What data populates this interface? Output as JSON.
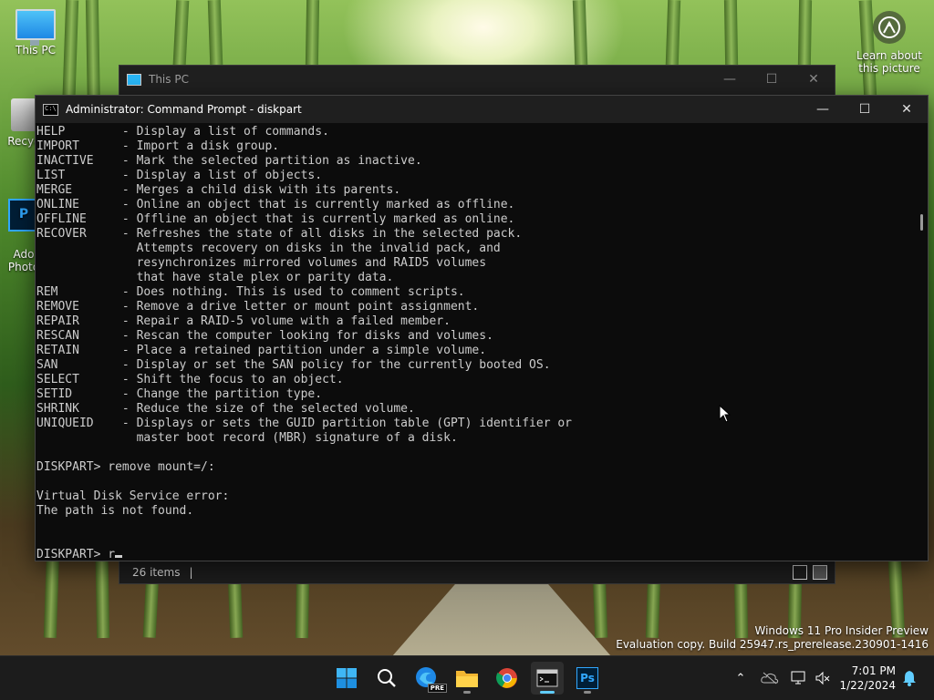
{
  "desktop": {
    "icons": [
      {
        "label": "This PC"
      },
      {
        "label": "Recyc"
      },
      {
        "label": "Ado\nPhoto"
      }
    ],
    "learn_label": "Learn about this picture"
  },
  "explorer": {
    "title": "This PC",
    "status_count": "26 items"
  },
  "cmd": {
    "title": "Administrator: Command Prompt - diskpart",
    "lines": [
      "HELP        - Display a list of commands.",
      "IMPORT      - Import a disk group.",
      "INACTIVE    - Mark the selected partition as inactive.",
      "LIST        - Display a list of objects.",
      "MERGE       - Merges a child disk with its parents.",
      "ONLINE      - Online an object that is currently marked as offline.",
      "OFFLINE     - Offline an object that is currently marked as online.",
      "RECOVER     - Refreshes the state of all disks in the selected pack.",
      "              Attempts recovery on disks in the invalid pack, and",
      "              resynchronizes mirrored volumes and RAID5 volumes",
      "              that have stale plex or parity data.",
      "REM         - Does nothing. This is used to comment scripts.",
      "REMOVE      - Remove a drive letter or mount point assignment.",
      "REPAIR      - Repair a RAID-5 volume with a failed member.",
      "RESCAN      - Rescan the computer looking for disks and volumes.",
      "RETAIN      - Place a retained partition under a simple volume.",
      "SAN         - Display or set the SAN policy for the currently booted OS.",
      "SELECT      - Shift the focus to an object.",
      "SETID       - Change the partition type.",
      "SHRINK      - Reduce the size of the selected volume.",
      "UNIQUEID    - Displays or sets the GUID partition table (GPT) identifier or",
      "              master boot record (MBR) signature of a disk.",
      "",
      "DISKPART> remove mount=/:",
      "",
      "Virtual Disk Service error:",
      "The path is not found.",
      "",
      ""
    ],
    "prompt": "DISKPART> ",
    "input": "r"
  },
  "watermark": {
    "line1": "Windows 11 Pro Insider Preview",
    "line2": "Evaluation copy. Build 25947.rs_prerelease.230901-1416"
  },
  "taskbar": {
    "apps": [
      {
        "icon": "windows-start-icon"
      },
      {
        "icon": "search-icon"
      },
      {
        "icon": "edge-beta-icon"
      },
      {
        "icon": "file-explorer-icon"
      },
      {
        "icon": "chrome-icon"
      },
      {
        "icon": "terminal-icon"
      },
      {
        "icon": "photoshop-icon"
      }
    ],
    "edge_badge": "PRE",
    "ps_label": "Ps",
    "time": "7:01 PM",
    "date": "1/22/2024"
  }
}
